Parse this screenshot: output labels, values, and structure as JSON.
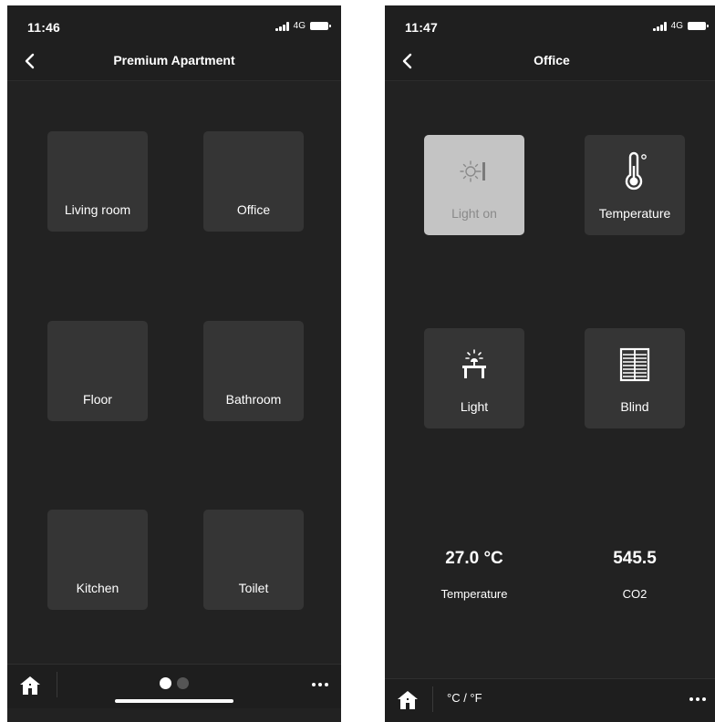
{
  "left_screen": {
    "status": {
      "time": "11:46",
      "network": "4G"
    },
    "nav": {
      "title": "Premium Apartment"
    },
    "rooms": [
      {
        "label": "Living room"
      },
      {
        "label": "Office"
      },
      {
        "label": "Floor"
      },
      {
        "label": "Bathroom"
      },
      {
        "label": "Kitchen"
      },
      {
        "label": "Toilet"
      }
    ],
    "pager": {
      "page_count": 2,
      "current_page": 1
    }
  },
  "right_screen": {
    "status": {
      "time": "11:47",
      "network": "4G"
    },
    "nav": {
      "title": "Office"
    },
    "devices": [
      {
        "label": "Light on",
        "icon": "bulb-switch-icon",
        "active": true
      },
      {
        "label": "Temperature",
        "icon": "thermometer-icon",
        "active": false
      },
      {
        "label": "Light",
        "icon": "desk-lamp-icon",
        "active": false
      },
      {
        "label": "Blind",
        "icon": "blind-icon",
        "active": false
      }
    ],
    "readings": [
      {
        "value": "27.0 °C",
        "label": "Temperature"
      },
      {
        "value": "545.5",
        "label": "CO2"
      }
    ],
    "bottom": {
      "unit_toggle": "°C / °F"
    }
  },
  "colors": {
    "background": "#222222",
    "tile": "#353535",
    "tile_active": "#c4c4c4",
    "text": "#ffffff"
  }
}
